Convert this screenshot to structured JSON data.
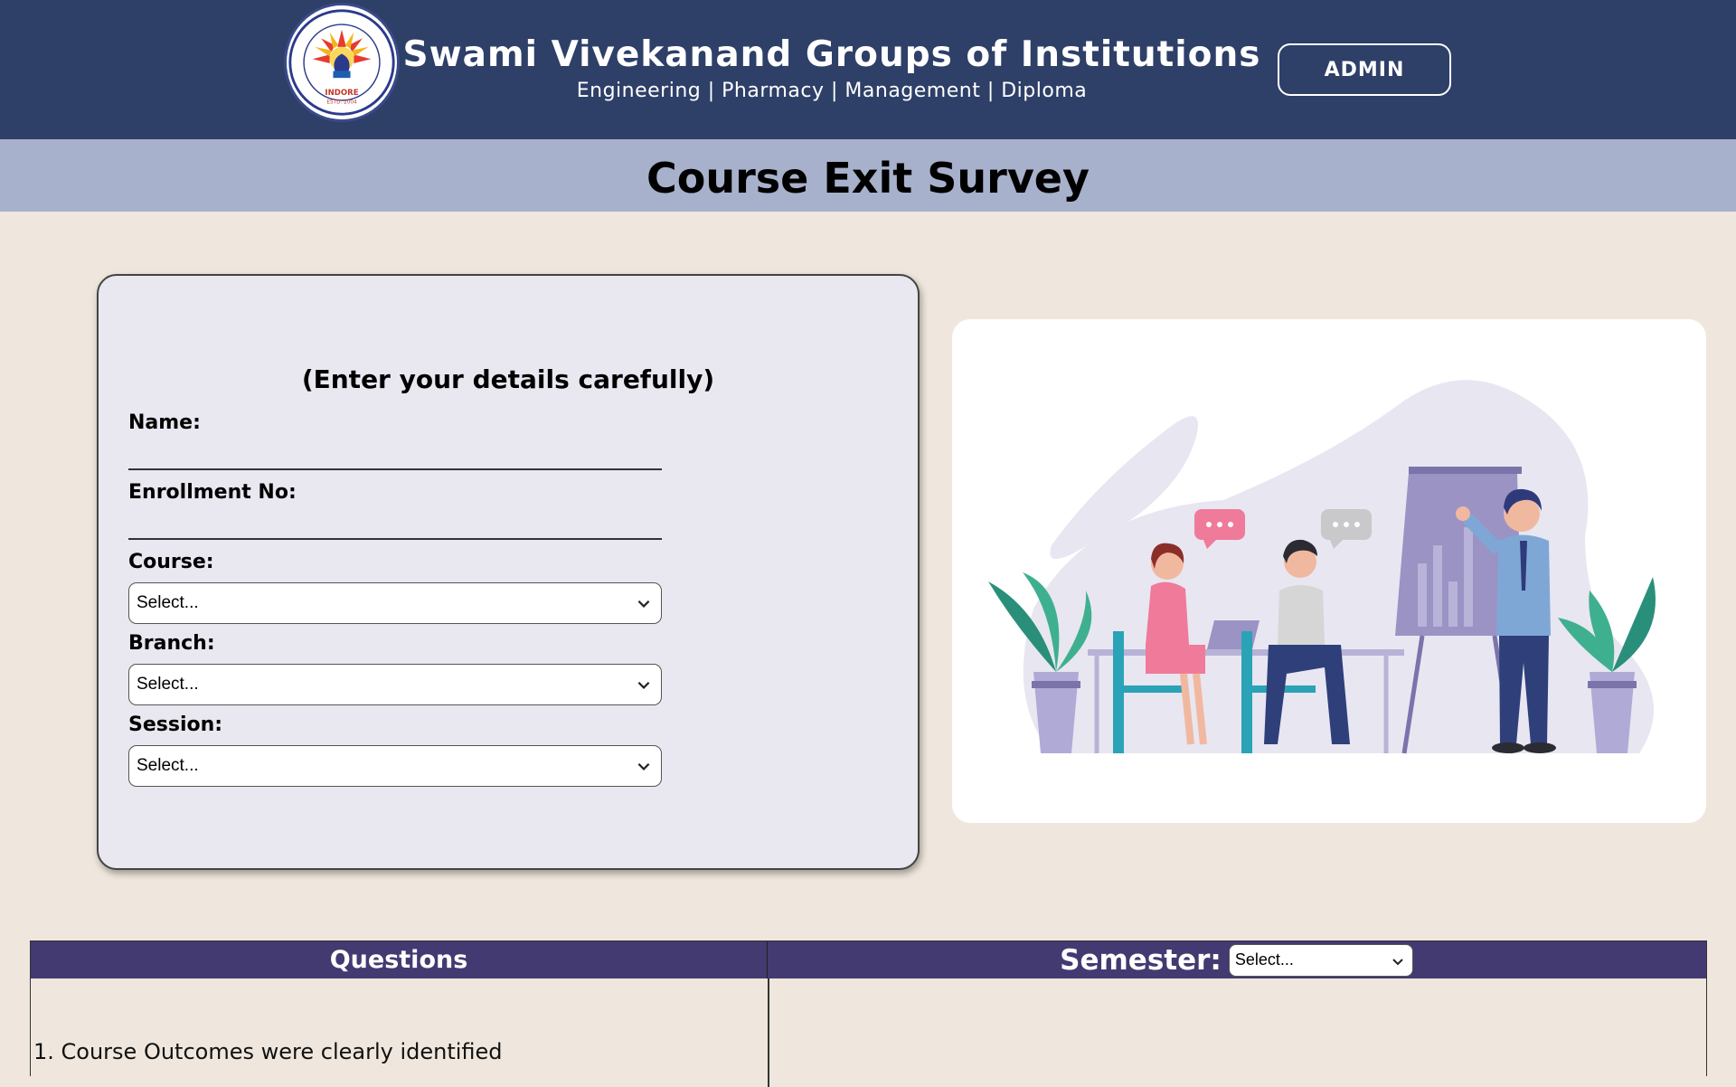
{
  "header": {
    "logo_text_top": "Swami Vivekanand College of Engineering",
    "logo_text_bottom": "INDORE",
    "logo_estd": "ESTD. 2004",
    "title": "Swami Vivekanand Groups of Institutions",
    "subtitle": "Engineering | Pharmacy | Management | Diploma",
    "admin_label": "ADMIN"
  },
  "page": {
    "title": "Course Exit Survey"
  },
  "form": {
    "heading": "(Enter your details carefully)",
    "name_label": "Name:",
    "name_value": "",
    "enrollment_label": "Enrollment No:",
    "enrollment_value": "",
    "course_label": "Course:",
    "course_selected": "Select...",
    "branch_label": "Branch:",
    "branch_selected": "Select...",
    "session_label": "Session:",
    "session_selected": "Select..."
  },
  "table": {
    "questions_header": "Questions",
    "semester_label": "Semester:",
    "semester_selected": "Select...",
    "questions": [
      "1. Course Outcomes were clearly identified"
    ]
  },
  "colors": {
    "header_bg": "#2e3f68",
    "title_bar_bg": "#a8b1cb",
    "page_bg": "#efe7dd",
    "card_bg": "#e9e7ef",
    "table_header_bg": "#433a72"
  },
  "icons": {
    "select_chevron": "chevron-down-icon",
    "logo": "college-logo",
    "illustration": "classroom-presentation-illustration"
  }
}
